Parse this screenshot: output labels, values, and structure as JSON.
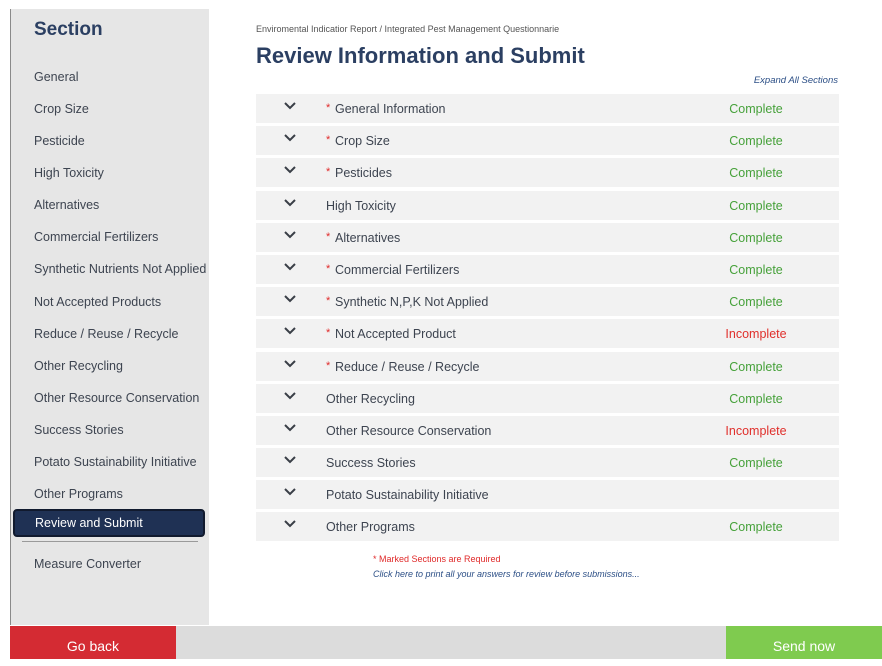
{
  "sidebar": {
    "heading": "Section",
    "items": [
      {
        "label": "General"
      },
      {
        "label": "Crop Size"
      },
      {
        "label": "Pesticide"
      },
      {
        "label": "High Toxicity"
      },
      {
        "label": "Alternatives"
      },
      {
        "label": "Commercial Fertilizers"
      },
      {
        "label": "Synthetic Nutrients Not Applied"
      },
      {
        "label": "Not Accepted Products"
      },
      {
        "label": "Reduce / Reuse / Recycle"
      },
      {
        "label": "Other Recycling"
      },
      {
        "label": "Other Resource Conservation"
      },
      {
        "label": "Success Stories"
      },
      {
        "label": "Potato Sustainability Initiative"
      },
      {
        "label": "Other Programs"
      },
      {
        "label": "Review and Submit"
      }
    ],
    "active_item": "Review and Submit",
    "extra_item": "Measure Converter"
  },
  "main": {
    "breadcrumb": "Enviromental Indicatior Report / Integrated Pest Management Questionnarie",
    "title": "Review Information and Submit",
    "expand_all": "Expand All Sections",
    "rows": [
      {
        "required": "*",
        "label": "General Information",
        "status": "Complete"
      },
      {
        "required": "*",
        "label": "Crop Size",
        "status": "Complete"
      },
      {
        "required": "*",
        "label": "Pesticides",
        "status": "Complete"
      },
      {
        "required": "",
        "label": "High Toxicity",
        "status": "Complete"
      },
      {
        "required": "*",
        "label": "Alternatives",
        "status": "Complete"
      },
      {
        "required": "*",
        "label": "Commercial Fertilizers",
        "status": "Complete"
      },
      {
        "required": "*",
        "label": "Synthetic N,P,K Not Applied",
        "status": "Complete"
      },
      {
        "required": "*",
        "label": "Not Accepted Product",
        "status": "Incomplete"
      },
      {
        "required": "*",
        "label": "Reduce / Reuse / Recycle",
        "status": "Complete"
      },
      {
        "required": "",
        "label": "Other Recycling",
        "status": "Complete"
      },
      {
        "required": "",
        "label": "Other Resource Conservation",
        "status": "Incomplete"
      },
      {
        "required": "",
        "label": "Success Stories",
        "status": "Complete"
      },
      {
        "required": "",
        "label": "Potato Sustainability Initiative",
        "status": ""
      },
      {
        "required": "",
        "label": "Other Programs",
        "status": "Complete"
      }
    ],
    "required_note": "* Marked Sections are Required",
    "print_link": "Click here to print all your answers for review before submissions..."
  },
  "footer": {
    "back_label": "Go back",
    "send_label": "Send now"
  },
  "colors": {
    "complete": "#46a13a",
    "incomplete": "#e0302c",
    "active_nav": "#1f3154",
    "back_button": "#d42b33",
    "send_button": "#7fcb4f"
  },
  "icons": {
    "row_toggle": "chevron-down-icon"
  }
}
